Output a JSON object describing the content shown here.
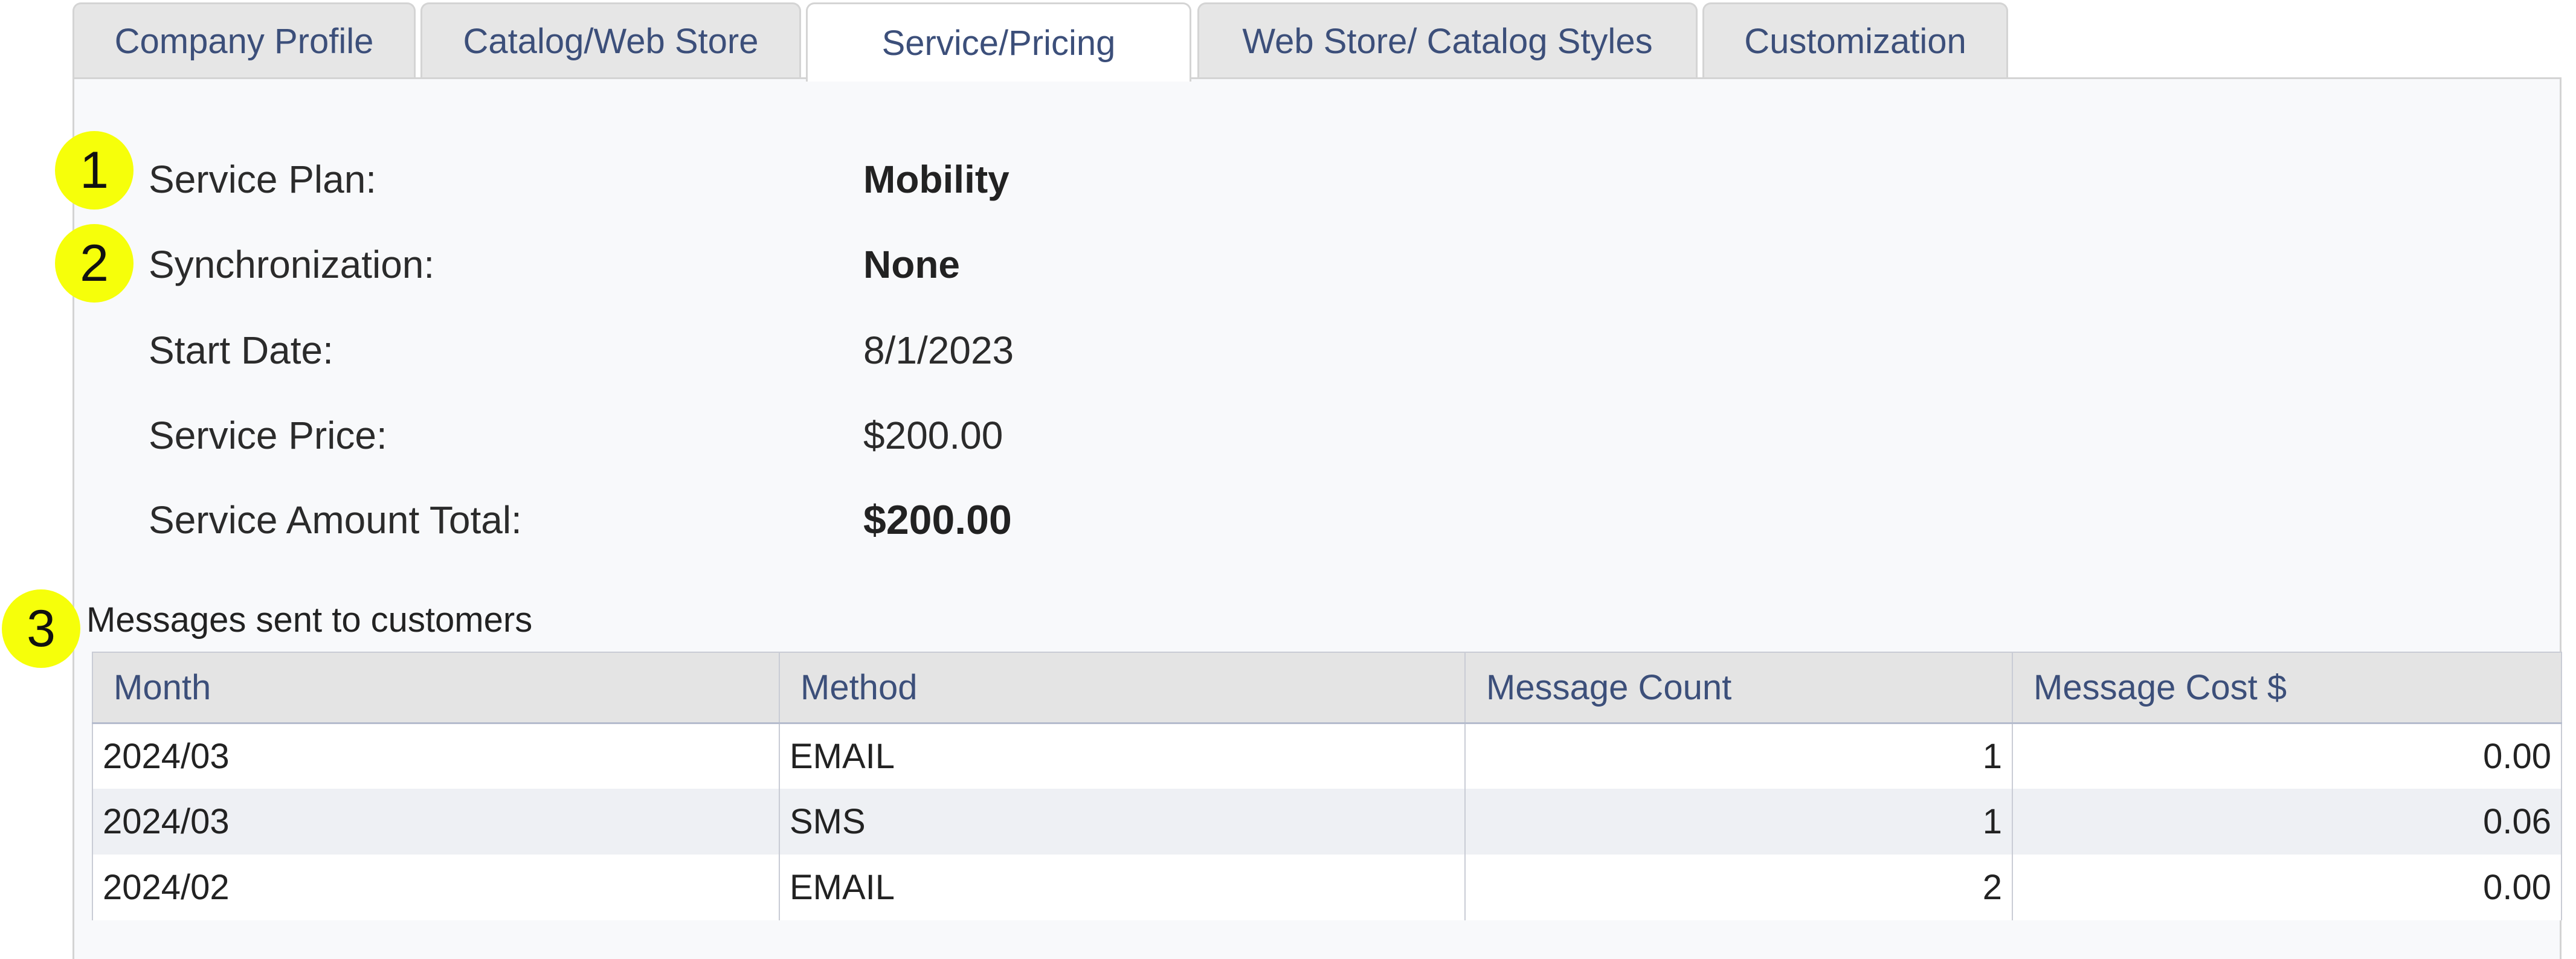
{
  "tabs": [
    {
      "label": "Company Profile",
      "active": false
    },
    {
      "label": "Catalog/Web Store",
      "active": false
    },
    {
      "label": "Service/Pricing",
      "active": true
    },
    {
      "label": "Web Store/ Catalog Styles",
      "active": false
    },
    {
      "label": "Customization",
      "active": false
    }
  ],
  "service": {
    "plan_label": "Service Plan:",
    "plan_value": "Mobility",
    "sync_label": "Synchronization:",
    "sync_value": "None",
    "start_label": "Start Date:",
    "start_value": "8/1/2023",
    "price_label": "Service Price:",
    "price_value": "$200.00",
    "total_label": "Service Amount Total:",
    "total_value": "$200.00"
  },
  "markers": [
    "1",
    "2",
    "3"
  ],
  "messages": {
    "title": "Messages sent to customers",
    "columns": [
      "Month",
      "Method",
      "Message Count",
      "Message Cost $"
    ],
    "rows": [
      {
        "month": "2024/03",
        "method": "EMAIL",
        "count": "1",
        "cost": "0.00"
      },
      {
        "month": "2024/03",
        "method": "SMS",
        "count": "1",
        "cost": "0.06"
      },
      {
        "month": "2024/02",
        "method": "EMAIL",
        "count": "2",
        "cost": "0.00"
      }
    ]
  },
  "colors": {
    "marker": "#f6ff0a",
    "tab_text": "#3c4f7a",
    "panel_bg": "#f8f9fb",
    "header_bg": "#e4e4e4"
  }
}
